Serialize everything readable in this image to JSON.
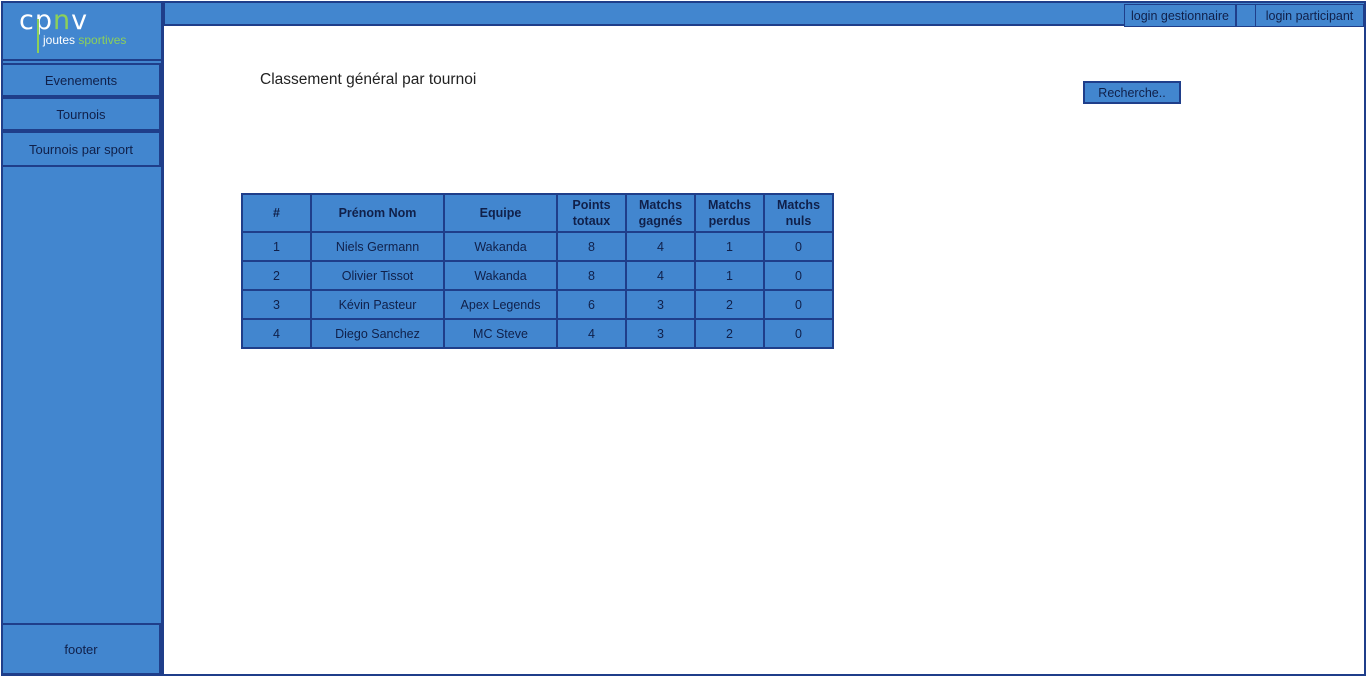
{
  "logo": {
    "main_prefix": "cp",
    "main_accent": "n",
    "main_suffix": "v",
    "sub_prefix": "joutes ",
    "sub_accent": "sportives"
  },
  "sidebar": {
    "items": [
      {
        "label": "Evenements"
      },
      {
        "label": "Tournois"
      },
      {
        "label": "Tournois par sport"
      }
    ],
    "footer": "footer"
  },
  "topbar": {
    "login_manager": "login gestionnaire",
    "login_participant": "login participant"
  },
  "main": {
    "title": "Classement général par tournoi",
    "search_label": "Recherche.."
  },
  "table": {
    "headers": [
      "#",
      "Prénom Nom",
      "Equipe",
      "Points totaux",
      "Matchs gagnés",
      "Matchs perdus",
      "Matchs nuls"
    ],
    "rows": [
      [
        "1",
        "Niels Germann",
        "Wakanda",
        "8",
        "4",
        "1",
        "0"
      ],
      [
        "2",
        "Olivier Tissot",
        "Wakanda",
        "8",
        "4",
        "1",
        "0"
      ],
      [
        "3",
        "Kévin Pasteur",
        "Apex Legends",
        "6",
        "3",
        "2",
        "0"
      ],
      [
        "4",
        "Diego Sanchez",
        "MC Steve",
        "4",
        "3",
        "2",
        "0"
      ]
    ]
  },
  "colors": {
    "panel_blue": "#4286CF",
    "border_navy": "#1F3E8A",
    "logo_accent": "#8CD05A"
  }
}
